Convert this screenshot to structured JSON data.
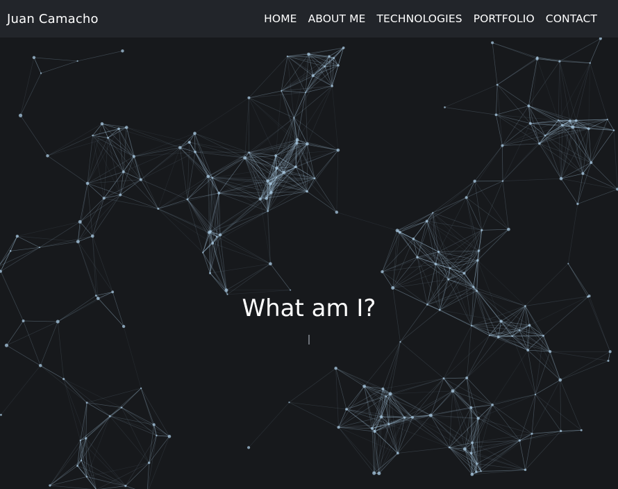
{
  "navbar": {
    "brand": "Juan Camacho",
    "links": [
      {
        "label": "HOME"
      },
      {
        "label": "ABOUT ME"
      },
      {
        "label": "TECHNOLOGIES"
      },
      {
        "label": "PORTFOLIO"
      },
      {
        "label": "CONTACT"
      }
    ]
  },
  "hero": {
    "title": "What am I?",
    "typing_cursor": "blinking-text-cursor"
  },
  "colors": {
    "navbar_bg": "#22252a",
    "hero_bg": "#17191c",
    "network_line": "#a8c8e0",
    "text": "#ffffff"
  }
}
